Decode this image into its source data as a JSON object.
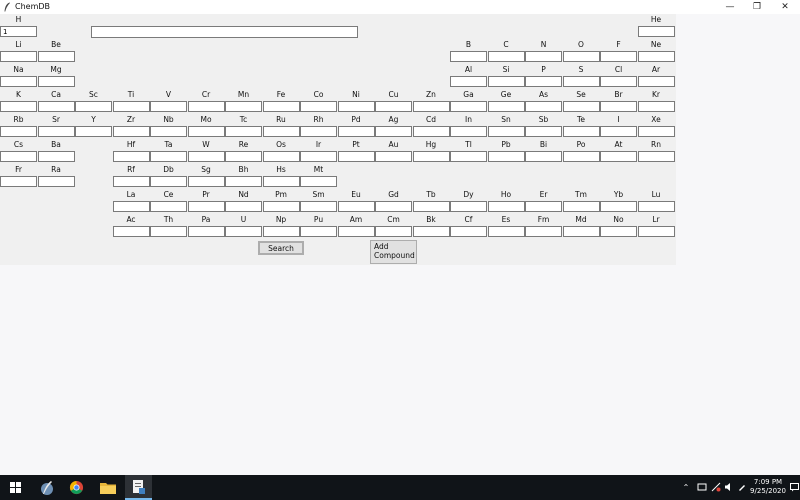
{
  "window": {
    "title": "ChemDB",
    "minimize_glyph": "—",
    "maximize_glyph": "❐",
    "close_glyph": "✕"
  },
  "search": {
    "value": ""
  },
  "buttons": {
    "search": "Search",
    "add_compound": "Add Compound"
  },
  "elements": [
    {
      "symbol": "H",
      "row": 0,
      "col": 0,
      "value": "1"
    },
    {
      "symbol": "He",
      "row": 0,
      "col": 17,
      "value": ""
    },
    {
      "symbol": "Li",
      "row": 1,
      "col": 0,
      "value": ""
    },
    {
      "symbol": "Be",
      "row": 1,
      "col": 1,
      "value": ""
    },
    {
      "symbol": "B",
      "row": 1,
      "col": 12,
      "value": ""
    },
    {
      "symbol": "C",
      "row": 1,
      "col": 13,
      "value": ""
    },
    {
      "symbol": "N",
      "row": 1,
      "col": 14,
      "value": ""
    },
    {
      "symbol": "O",
      "row": 1,
      "col": 15,
      "value": ""
    },
    {
      "symbol": "F",
      "row": 1,
      "col": 16,
      "value": ""
    },
    {
      "symbol": "Ne",
      "row": 1,
      "col": 17,
      "value": ""
    },
    {
      "symbol": "Na",
      "row": 2,
      "col": 0,
      "value": ""
    },
    {
      "symbol": "Mg",
      "row": 2,
      "col": 1,
      "value": ""
    },
    {
      "symbol": "Al",
      "row": 2,
      "col": 12,
      "value": ""
    },
    {
      "symbol": "Si",
      "row": 2,
      "col": 13,
      "value": ""
    },
    {
      "symbol": "P",
      "row": 2,
      "col": 14,
      "value": ""
    },
    {
      "symbol": "S",
      "row": 2,
      "col": 15,
      "value": ""
    },
    {
      "symbol": "Cl",
      "row": 2,
      "col": 16,
      "value": ""
    },
    {
      "symbol": "Ar",
      "row": 2,
      "col": 17,
      "value": ""
    },
    {
      "symbol": "K",
      "row": 3,
      "col": 0,
      "value": ""
    },
    {
      "symbol": "Ca",
      "row": 3,
      "col": 1,
      "value": ""
    },
    {
      "symbol": "Sc",
      "row": 3,
      "col": 2,
      "value": ""
    },
    {
      "symbol": "Ti",
      "row": 3,
      "col": 3,
      "value": ""
    },
    {
      "symbol": "V",
      "row": 3,
      "col": 4,
      "value": ""
    },
    {
      "symbol": "Cr",
      "row": 3,
      "col": 5,
      "value": ""
    },
    {
      "symbol": "Mn",
      "row": 3,
      "col": 6,
      "value": ""
    },
    {
      "symbol": "Fe",
      "row": 3,
      "col": 7,
      "value": ""
    },
    {
      "symbol": "Co",
      "row": 3,
      "col": 8,
      "value": ""
    },
    {
      "symbol": "Ni",
      "row": 3,
      "col": 9,
      "value": ""
    },
    {
      "symbol": "Cu",
      "row": 3,
      "col": 10,
      "value": ""
    },
    {
      "symbol": "Zn",
      "row": 3,
      "col": 11,
      "value": ""
    },
    {
      "symbol": "Ga",
      "row": 3,
      "col": 12,
      "value": ""
    },
    {
      "symbol": "Ge",
      "row": 3,
      "col": 13,
      "value": ""
    },
    {
      "symbol": "As",
      "row": 3,
      "col": 14,
      "value": ""
    },
    {
      "symbol": "Se",
      "row": 3,
      "col": 15,
      "value": ""
    },
    {
      "symbol": "Br",
      "row": 3,
      "col": 16,
      "value": ""
    },
    {
      "symbol": "Kr",
      "row": 3,
      "col": 17,
      "value": ""
    },
    {
      "symbol": "Rb",
      "row": 4,
      "col": 0,
      "value": ""
    },
    {
      "symbol": "Sr",
      "row": 4,
      "col": 1,
      "value": ""
    },
    {
      "symbol": "Y",
      "row": 4,
      "col": 2,
      "value": ""
    },
    {
      "symbol": "Zr",
      "row": 4,
      "col": 3,
      "value": ""
    },
    {
      "symbol": "Nb",
      "row": 4,
      "col": 4,
      "value": ""
    },
    {
      "symbol": "Mo",
      "row": 4,
      "col": 5,
      "value": ""
    },
    {
      "symbol": "Tc",
      "row": 4,
      "col": 6,
      "value": ""
    },
    {
      "symbol": "Ru",
      "row": 4,
      "col": 7,
      "value": ""
    },
    {
      "symbol": "Rh",
      "row": 4,
      "col": 8,
      "value": ""
    },
    {
      "symbol": "Pd",
      "row": 4,
      "col": 9,
      "value": ""
    },
    {
      "symbol": "Ag",
      "row": 4,
      "col": 10,
      "value": ""
    },
    {
      "symbol": "Cd",
      "row": 4,
      "col": 11,
      "value": ""
    },
    {
      "symbol": "In",
      "row": 4,
      "col": 12,
      "value": ""
    },
    {
      "symbol": "Sn",
      "row": 4,
      "col": 13,
      "value": ""
    },
    {
      "symbol": "Sb",
      "row": 4,
      "col": 14,
      "value": ""
    },
    {
      "symbol": "Te",
      "row": 4,
      "col": 15,
      "value": ""
    },
    {
      "symbol": "I",
      "row": 4,
      "col": 16,
      "value": ""
    },
    {
      "symbol": "Xe",
      "row": 4,
      "col": 17,
      "value": ""
    },
    {
      "symbol": "Cs",
      "row": 5,
      "col": 0,
      "value": ""
    },
    {
      "symbol": "Ba",
      "row": 5,
      "col": 1,
      "value": ""
    },
    {
      "symbol": "Hf",
      "row": 5,
      "col": 3,
      "value": ""
    },
    {
      "symbol": "Ta",
      "row": 5,
      "col": 4,
      "value": ""
    },
    {
      "symbol": "W",
      "row": 5,
      "col": 5,
      "value": ""
    },
    {
      "symbol": "Re",
      "row": 5,
      "col": 6,
      "value": ""
    },
    {
      "symbol": "Os",
      "row": 5,
      "col": 7,
      "value": ""
    },
    {
      "symbol": "Ir",
      "row": 5,
      "col": 8,
      "value": ""
    },
    {
      "symbol": "Pt",
      "row": 5,
      "col": 9,
      "value": ""
    },
    {
      "symbol": "Au",
      "row": 5,
      "col": 10,
      "value": ""
    },
    {
      "symbol": "Hg",
      "row": 5,
      "col": 11,
      "value": ""
    },
    {
      "symbol": "Tl",
      "row": 5,
      "col": 12,
      "value": ""
    },
    {
      "symbol": "Pb",
      "row": 5,
      "col": 13,
      "value": ""
    },
    {
      "symbol": "Bi",
      "row": 5,
      "col": 14,
      "value": ""
    },
    {
      "symbol": "Po",
      "row": 5,
      "col": 15,
      "value": ""
    },
    {
      "symbol": "At",
      "row": 5,
      "col": 16,
      "value": ""
    },
    {
      "symbol": "Rn",
      "row": 5,
      "col": 17,
      "value": ""
    },
    {
      "symbol": "Fr",
      "row": 6,
      "col": 0,
      "value": ""
    },
    {
      "symbol": "Ra",
      "row": 6,
      "col": 1,
      "value": ""
    },
    {
      "symbol": "Rf",
      "row": 6,
      "col": 3,
      "value": ""
    },
    {
      "symbol": "Db",
      "row": 6,
      "col": 4,
      "value": ""
    },
    {
      "symbol": "Sg",
      "row": 6,
      "col": 5,
      "value": ""
    },
    {
      "symbol": "Bh",
      "row": 6,
      "col": 6,
      "value": ""
    },
    {
      "symbol": "Hs",
      "row": 6,
      "col": 7,
      "value": ""
    },
    {
      "symbol": "Mt",
      "row": 6,
      "col": 8,
      "value": ""
    },
    {
      "symbol": "La",
      "row": 7,
      "col": 3,
      "value": ""
    },
    {
      "symbol": "Ce",
      "row": 7,
      "col": 4,
      "value": ""
    },
    {
      "symbol": "Pr",
      "row": 7,
      "col": 5,
      "value": ""
    },
    {
      "symbol": "Nd",
      "row": 7,
      "col": 6,
      "value": ""
    },
    {
      "symbol": "Pm",
      "row": 7,
      "col": 7,
      "value": ""
    },
    {
      "symbol": "Sm",
      "row": 7,
      "col": 8,
      "value": ""
    },
    {
      "symbol": "Eu",
      "row": 7,
      "col": 9,
      "value": ""
    },
    {
      "symbol": "Gd",
      "row": 7,
      "col": 10,
      "value": ""
    },
    {
      "symbol": "Tb",
      "row": 7,
      "col": 11,
      "value": ""
    },
    {
      "symbol": "Dy",
      "row": 7,
      "col": 12,
      "value": ""
    },
    {
      "symbol": "Ho",
      "row": 7,
      "col": 13,
      "value": ""
    },
    {
      "symbol": "Er",
      "row": 7,
      "col": 14,
      "value": ""
    },
    {
      "symbol": "Tm",
      "row": 7,
      "col": 15,
      "value": ""
    },
    {
      "symbol": "Yb",
      "row": 7,
      "col": 16,
      "value": ""
    },
    {
      "symbol": "Lu",
      "row": 7,
      "col": 17,
      "value": ""
    },
    {
      "symbol": "Ac",
      "row": 8,
      "col": 3,
      "value": ""
    },
    {
      "symbol": "Th",
      "row": 8,
      "col": 4,
      "value": ""
    },
    {
      "symbol": "Pa",
      "row": 8,
      "col": 5,
      "value": ""
    },
    {
      "symbol": "U",
      "row": 8,
      "col": 6,
      "value": ""
    },
    {
      "symbol": "Np",
      "row": 8,
      "col": 7,
      "value": ""
    },
    {
      "symbol": "Pu",
      "row": 8,
      "col": 8,
      "value": ""
    },
    {
      "symbol": "Am",
      "row": 8,
      "col": 9,
      "value": ""
    },
    {
      "symbol": "Cm",
      "row": 8,
      "col": 10,
      "value": ""
    },
    {
      "symbol": "Bk",
      "row": 8,
      "col": 11,
      "value": ""
    },
    {
      "symbol": "Cf",
      "row": 8,
      "col": 12,
      "value": ""
    },
    {
      "symbol": "Es",
      "row": 8,
      "col": 13,
      "value": ""
    },
    {
      "symbol": "Fm",
      "row": 8,
      "col": 14,
      "value": ""
    },
    {
      "symbol": "Md",
      "row": 8,
      "col": 15,
      "value": ""
    },
    {
      "symbol": "No",
      "row": 8,
      "col": 16,
      "value": ""
    },
    {
      "symbol": "Lr",
      "row": 8,
      "col": 17,
      "value": ""
    }
  ],
  "taskbar": {
    "apps": [
      {
        "name": "start-button",
        "icon": "windows-logo-icon"
      },
      {
        "name": "taskbar-app-python",
        "icon": "python-feather-icon"
      },
      {
        "name": "taskbar-app-chrome",
        "icon": "chrome-icon"
      },
      {
        "name": "taskbar-app-file-explorer",
        "icon": "folder-icon"
      },
      {
        "name": "taskbar-app-chemdb",
        "icon": "document-app-icon",
        "active": true
      }
    ],
    "tray": {
      "chevron_glyph": "⌃",
      "time": "7:09 PM",
      "date": "9/25/2020"
    }
  },
  "colors": {
    "client_bg": "#f0f0f0",
    "desktop_bg": "#f7f7f9",
    "taskbar_bg": "#101418",
    "active_app_underline": "#76b9ed"
  }
}
